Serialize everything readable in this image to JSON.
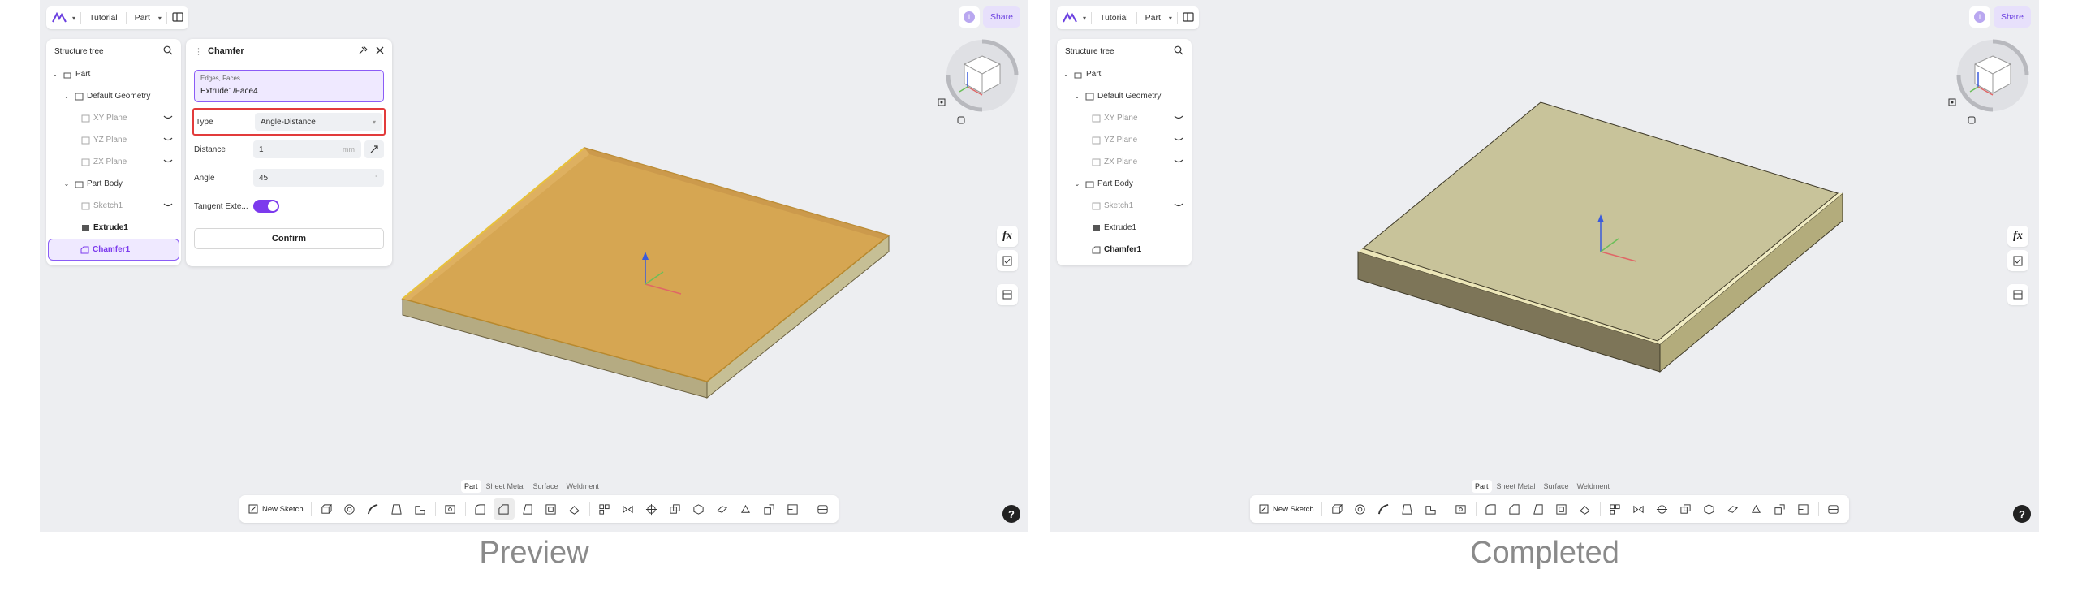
{
  "captions": {
    "left": "Preview",
    "right": "Completed"
  },
  "topbar": {
    "breadcrumb_1": "Tutorial",
    "breadcrumb_2": "Part",
    "share_label": "Share",
    "avatar_initial": "I"
  },
  "tree": {
    "title": "Structure tree",
    "items": [
      {
        "label": "Part"
      },
      {
        "label": "Default Geometry"
      },
      {
        "label": "XY Plane"
      },
      {
        "label": "YZ Plane"
      },
      {
        "label": "ZX Plane"
      },
      {
        "label": "Part Body"
      },
      {
        "label": "Sketch1"
      },
      {
        "label": "Extrude1"
      },
      {
        "label": "Chamfer1"
      }
    ]
  },
  "chamfer": {
    "title": "Chamfer",
    "edges_label": "Edges, Faces",
    "edges_value": "Extrude1/Face4",
    "type_label": "Type",
    "type_value": "Angle-Distance",
    "distance_label": "Distance",
    "distance_value": "1",
    "distance_unit": "mm",
    "angle_label": "Angle",
    "angle_value": "45",
    "tangent_label": "Tangent Exte...",
    "confirm_label": "Confirm"
  },
  "bottom": {
    "tabs": [
      "Part",
      "Sheet Metal",
      "Surface",
      "Weldment"
    ],
    "new_sketch": "New Sketch"
  },
  "side": {
    "fx_label": "fx"
  },
  "help": "?",
  "colors": {
    "accent": "#7c3aed",
    "highlight_red": "#e23b3b",
    "preview_body": "#d4a050",
    "completed_body": "#c9c49a"
  }
}
